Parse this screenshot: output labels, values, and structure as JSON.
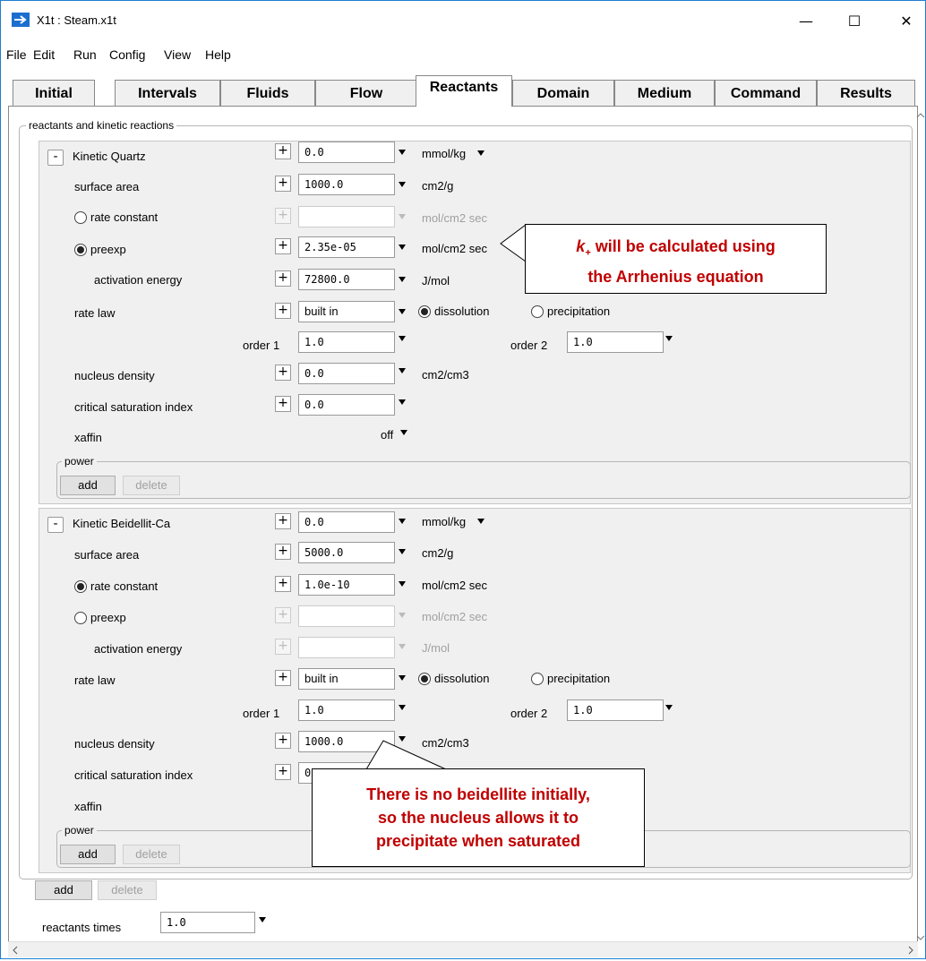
{
  "window": {
    "title": "X1t : Steam.x1t",
    "minimize": "—",
    "maximize": "☐",
    "close": "✕"
  },
  "menu": [
    "File",
    "Edit",
    "Run",
    "Config",
    "View",
    "Help"
  ],
  "tabs": [
    "Initial",
    "Intervals",
    "Fluids",
    "Flow",
    "Reactants",
    "Domain",
    "Medium",
    "Command",
    "Results"
  ],
  "active_tab": "Reactants",
  "group_title": "reactants and kinetic reactions",
  "reactions": [
    {
      "collapse": "-",
      "name": "Kinetic  Quartz",
      "amount": "0.0",
      "amount_unit": "mmol/kg",
      "surface_area_label": "surface area",
      "surface_area": "1000.0",
      "surface_area_unit": "cm2/g",
      "rate_constant_label": "rate constant",
      "rate_constant": "",
      "rate_constant_unit": "mol/cm2 sec",
      "rate_constant_selected": false,
      "preexp_label": "preexp",
      "preexp": "2.35e-05",
      "preexp_unit": "mol/cm2 sec",
      "preexp_selected": true,
      "activation_energy_label": "activation energy",
      "activation_energy": "72800.0",
      "activation_energy_unit": "J/mol",
      "rate_law_label": "rate law",
      "rate_law": "built in",
      "dissolution_label": "dissolution",
      "precipitation_label": "precipitation",
      "direction": "dissolution",
      "order1_label": "order 1",
      "order1": "1.0",
      "order2_label": "order 2",
      "order2": "1.0",
      "nucleus_density_label": "nucleus density",
      "nucleus_density": "0.0",
      "nucleus_density_unit": "cm2/cm3",
      "csi_label": "critical saturation index",
      "csi": "0.0",
      "xaffin_label": "xaffin",
      "xaffin": "off",
      "power_label": "power",
      "add": "add",
      "delete": "delete"
    },
    {
      "collapse": "-",
      "name": "Kinetic  Beidellit-Ca",
      "amount": "0.0",
      "amount_unit": "mmol/kg",
      "surface_area_label": "surface area",
      "surface_area": "5000.0",
      "surface_area_unit": "cm2/g",
      "rate_constant_label": "rate constant",
      "rate_constant": "1.0e-10",
      "rate_constant_unit": "mol/cm2 sec",
      "rate_constant_selected": true,
      "preexp_label": "preexp",
      "preexp": "",
      "preexp_unit": "mol/cm2 sec",
      "preexp_selected": false,
      "activation_energy_label": "activation energy",
      "activation_energy": "",
      "activation_energy_unit": "J/mol",
      "rate_law_label": "rate law",
      "rate_law": "built in",
      "dissolution_label": "dissolution",
      "precipitation_label": "precipitation",
      "direction": "dissolution",
      "order1_label": "order 1",
      "order1": "1.0",
      "order2_label": "order 2",
      "order2": "1.0",
      "nucleus_density_label": "nucleus density",
      "nucleus_density": "1000.0",
      "nucleus_density_unit": "cm2/cm3",
      "csi_label": "critical saturation index",
      "csi": "0.0",
      "xaffin_label": "xaffin",
      "xaffin": "",
      "power_label": "power",
      "add": "add",
      "delete": "delete"
    }
  ],
  "bottom": {
    "add": "add",
    "delete": "delete",
    "reactants_times_label": "reactants times",
    "reactants_times": "1.0"
  },
  "callouts": {
    "arrhenius": {
      "k_symbol": "k",
      "k_sub": "+",
      "line1_rest": " will be calculated using",
      "line2": "the Arrhenius equation"
    },
    "nucleus": {
      "line1": "There is no beidellite initially,",
      "line2": "so the nucleus allows it to",
      "line3": "precipitate when saturated"
    }
  },
  "colors": {
    "accent": "#c00000",
    "titlebar_icon": "#1c6fcf"
  }
}
